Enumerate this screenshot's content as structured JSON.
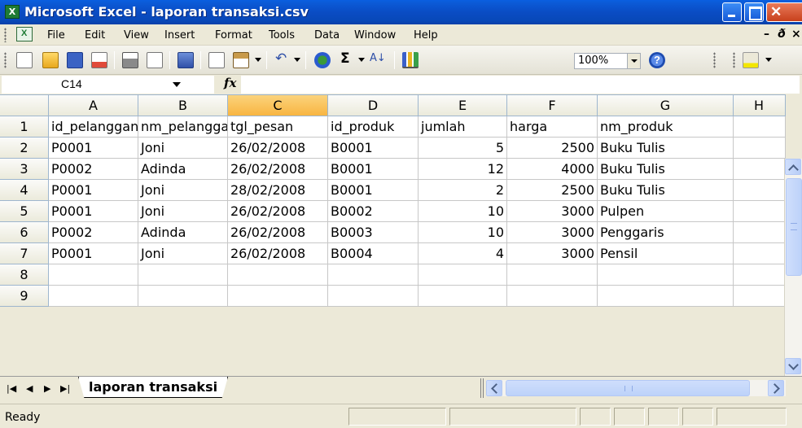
{
  "window": {
    "title": "Microsoft Excel - laporan transaksi.csv"
  },
  "menu": {
    "items": [
      "File",
      "Edit",
      "View",
      "Insert",
      "Format",
      "Tools",
      "Data",
      "Window",
      "Help"
    ]
  },
  "toolbar": {
    "zoom": "100%"
  },
  "formula_bar": {
    "name_box": "C14",
    "fx": "fx",
    "value": ""
  },
  "grid": {
    "columns": [
      "A",
      "B",
      "C",
      "D",
      "E",
      "F",
      "G",
      "H"
    ],
    "selected_column": "C",
    "rows": [
      {
        "n": "1",
        "cells": [
          "id_pelanggan",
          "nm_pelanggan",
          "tgl_pesan",
          "id_produk",
          "jumlah",
          "harga",
          "nm_produk",
          ""
        ]
      },
      {
        "n": "2",
        "cells": [
          "P0001",
          "Joni",
          "26/02/2008",
          "B0001",
          "5",
          "2500",
          "Buku Tulis",
          ""
        ]
      },
      {
        "n": "3",
        "cells": [
          "P0002",
          "Adinda",
          "26/02/2008",
          "B0001",
          "12",
          "4000",
          "Buku Tulis",
          ""
        ]
      },
      {
        "n": "4",
        "cells": [
          "P0001",
          "Joni",
          "28/02/2008",
          "B0001",
          "2",
          "2500",
          "Buku Tulis",
          ""
        ]
      },
      {
        "n": "5",
        "cells": [
          "P0001",
          "Joni",
          "26/02/2008",
          "B0002",
          "10",
          "3000",
          "Pulpen",
          ""
        ]
      },
      {
        "n": "6",
        "cells": [
          "P0002",
          "Adinda",
          "26/02/2008",
          "B0003",
          "10",
          "3000",
          "Penggaris",
          ""
        ]
      },
      {
        "n": "7",
        "cells": [
          "P0001",
          "Joni",
          "26/02/2008",
          "B0004",
          "4",
          "3000",
          "Pensil",
          ""
        ]
      },
      {
        "n": "8",
        "cells": [
          "",
          "",
          "",
          "",
          "",
          "",
          "",
          ""
        ]
      },
      {
        "n": "9",
        "cells": [
          "",
          "",
          "",
          "",
          "",
          "",
          "",
          ""
        ]
      }
    ]
  },
  "sheets": {
    "active": "laporan transaksi"
  },
  "status": {
    "text": "Ready"
  },
  "colors": {
    "title_bar": "#0a4cc4",
    "selected_header": "#f8b541",
    "excel_green": "#1e7b34"
  },
  "icons": [
    "excel-app-icon",
    "new-icon",
    "open-icon",
    "save-icon",
    "permission-icon",
    "print-icon",
    "print-preview-icon",
    "research-icon",
    "copy-icon",
    "paste-icon",
    "undo-icon",
    "hyperlink-icon",
    "autosum-icon",
    "sort-ascending-icon",
    "chart-wizard-icon",
    "help-icon",
    "fill-color-icon"
  ]
}
